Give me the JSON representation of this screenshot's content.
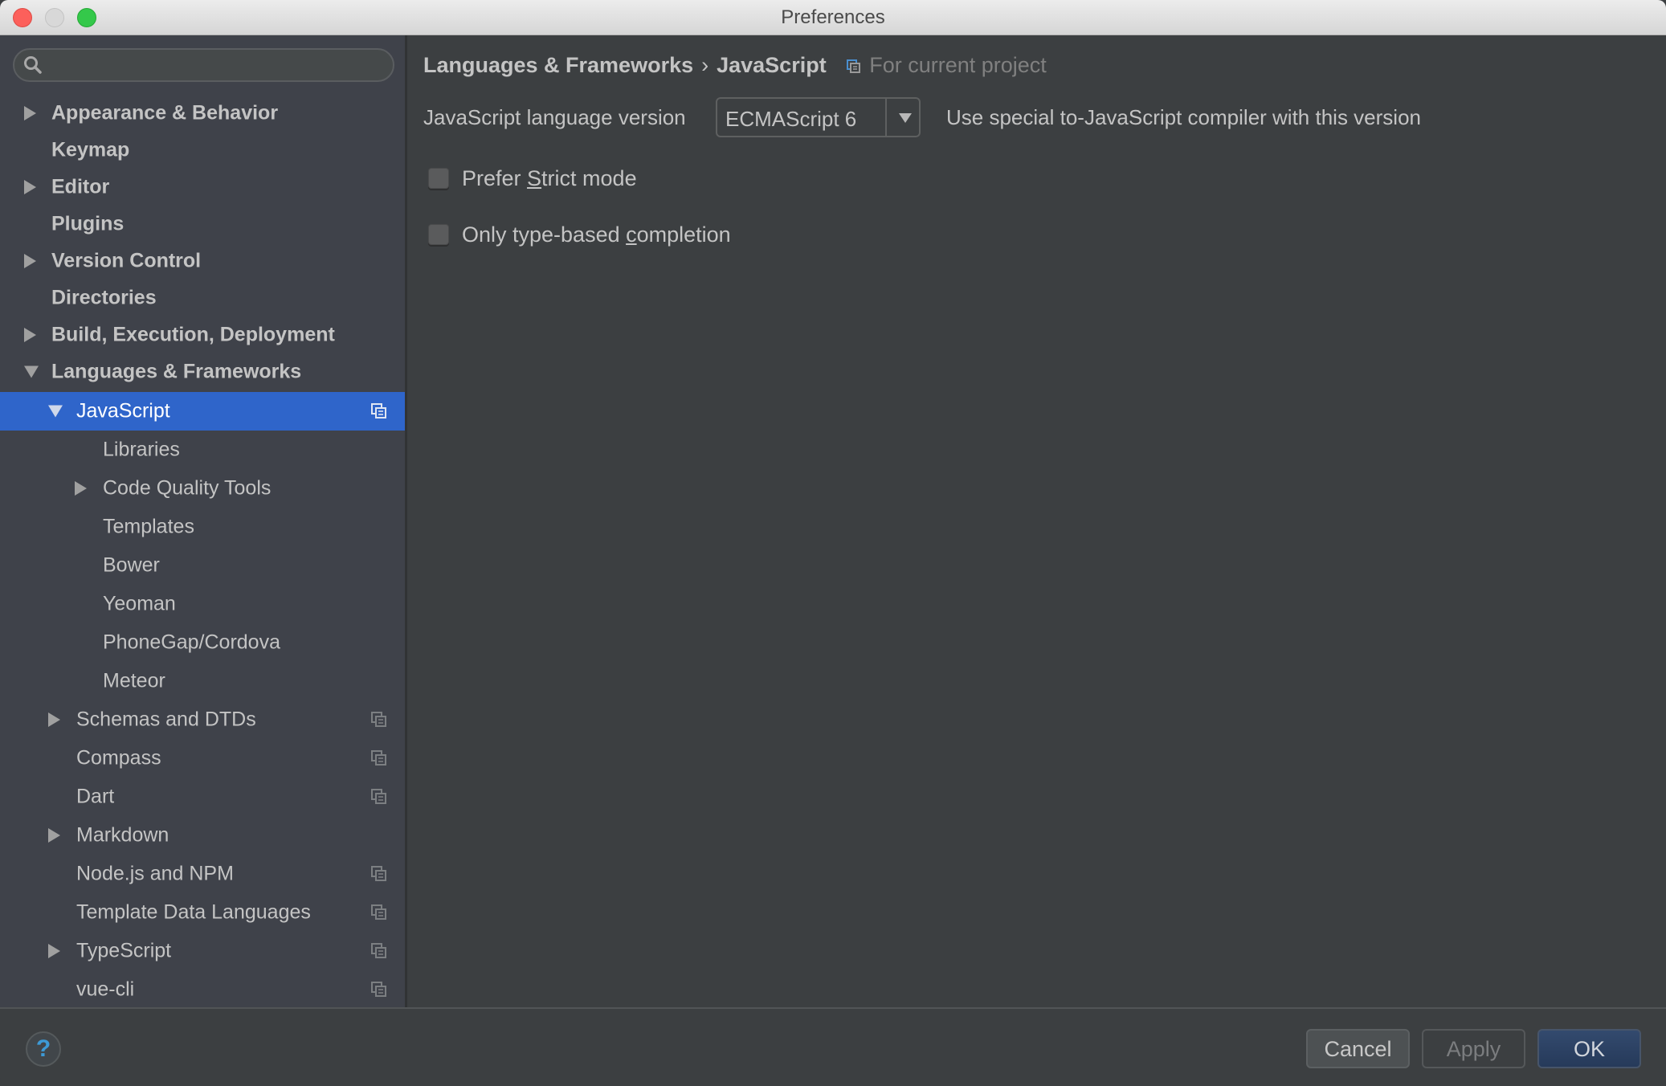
{
  "window": {
    "title": "Preferences"
  },
  "sidebar": {
    "search": {
      "value": "",
      "placeholder": ""
    },
    "items": [
      {
        "label": "Appearance & Behavior",
        "level": 0,
        "expander": "collapsed",
        "project_icon": false
      },
      {
        "label": "Keymap",
        "level": 0,
        "expander": "none",
        "project_icon": false
      },
      {
        "label": "Editor",
        "level": 0,
        "expander": "collapsed",
        "project_icon": false
      },
      {
        "label": "Plugins",
        "level": 0,
        "expander": "none",
        "project_icon": false
      },
      {
        "label": "Version Control",
        "level": 0,
        "expander": "collapsed",
        "project_icon": false
      },
      {
        "label": "Directories",
        "level": 0,
        "expander": "none",
        "project_icon": false
      },
      {
        "label": "Build, Execution, Deployment",
        "level": 0,
        "expander": "collapsed",
        "project_icon": false
      },
      {
        "label": "Languages & Frameworks",
        "level": 0,
        "expander": "expanded",
        "project_icon": false
      },
      {
        "label": "JavaScript",
        "level": 1,
        "expander": "expanded",
        "project_icon": true,
        "selected": true
      },
      {
        "label": "Libraries",
        "level": 2,
        "expander": "none",
        "project_icon": false
      },
      {
        "label": "Code Quality Tools",
        "level": 2,
        "expander": "collapsed",
        "project_icon": false
      },
      {
        "label": "Templates",
        "level": 2,
        "expander": "none",
        "project_icon": false
      },
      {
        "label": "Bower",
        "level": 2,
        "expander": "none",
        "project_icon": false
      },
      {
        "label": "Yeoman",
        "level": 2,
        "expander": "none",
        "project_icon": false
      },
      {
        "label": "PhoneGap/Cordova",
        "level": 2,
        "expander": "none",
        "project_icon": false
      },
      {
        "label": "Meteor",
        "level": 2,
        "expander": "none",
        "project_icon": false
      },
      {
        "label": "Schemas and DTDs",
        "level": 1,
        "expander": "collapsed",
        "project_icon": true
      },
      {
        "label": "Compass",
        "level": 1,
        "expander": "none",
        "project_icon": true
      },
      {
        "label": "Dart",
        "level": 1,
        "expander": "none",
        "project_icon": true
      },
      {
        "label": "Markdown",
        "level": 1,
        "expander": "collapsed",
        "project_icon": false
      },
      {
        "label": "Node.js and NPM",
        "level": 1,
        "expander": "none",
        "project_icon": true
      },
      {
        "label": "Template Data Languages",
        "level": 1,
        "expander": "none",
        "project_icon": true
      },
      {
        "label": "TypeScript",
        "level": 1,
        "expander": "collapsed",
        "project_icon": true
      },
      {
        "label": "vue-cli",
        "level": 1,
        "expander": "none",
        "project_icon": true
      }
    ]
  },
  "main": {
    "breadcrumb": {
      "parent": "Languages & Frameworks",
      "separator": "›",
      "current": "JavaScript",
      "scope_icon": "project-settings-icon",
      "scope": "For current project"
    },
    "language_version": {
      "label": "JavaScript language version",
      "value": "ECMAScript 6",
      "hint": "Use special to-JavaScript compiler with this version"
    },
    "checkboxes": [
      {
        "label_before": "Prefer ",
        "mnemonic": "S",
        "label_after": "trict mode",
        "checked": false
      },
      {
        "label_before": "Only type-based ",
        "mnemonic": "c",
        "label_after": "ompletion",
        "checked": false
      }
    ]
  },
  "footer": {
    "help_label": "?",
    "cancel_label": "Cancel",
    "apply_label": "Apply",
    "ok_label": "OK"
  },
  "colors": {
    "selection": "#2f65ca",
    "sidebar_bg": "#3f424a",
    "main_bg": "#3c3f41",
    "ok_button": "#2d4266",
    "help_icon": "#3d9ad6"
  }
}
